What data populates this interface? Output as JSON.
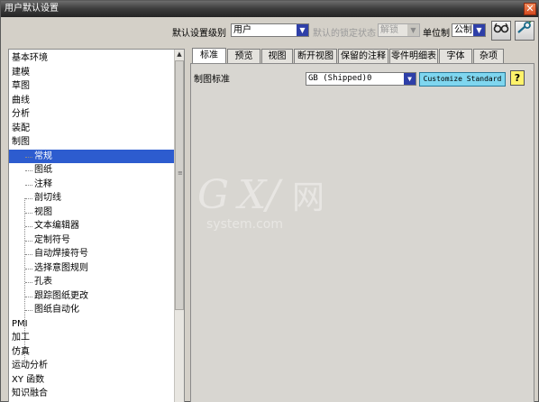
{
  "window": {
    "title": "用户默认设置",
    "close_glyph": "✕"
  },
  "toolbar": {
    "level_label": "默认设置级别",
    "level_value": "用户",
    "lock_label": "默认的锁定状态",
    "lock_value": "解锁",
    "unit_label": "单位制",
    "unit_value": "公制",
    "icon_1": "glasses-search-icon",
    "icon_2": "wrench-icon"
  },
  "tree": {
    "items": [
      {
        "label": "基本环境",
        "sub": false
      },
      {
        "label": "建模",
        "sub": false
      },
      {
        "label": "草图",
        "sub": false
      },
      {
        "label": "曲线",
        "sub": false
      },
      {
        "label": "分析",
        "sub": false
      },
      {
        "label": "装配",
        "sub": false
      },
      {
        "label": "制图",
        "sub": false
      },
      {
        "label": "常规",
        "sub": true,
        "selected": true
      },
      {
        "label": "图纸",
        "sub": true
      },
      {
        "label": "注释",
        "sub": true
      },
      {
        "label": "剖切线",
        "sub": true
      },
      {
        "label": "视图",
        "sub": true
      },
      {
        "label": "文本编辑器",
        "sub": true
      },
      {
        "label": "定制符号",
        "sub": true
      },
      {
        "label": "自动焊接符号",
        "sub": true
      },
      {
        "label": "选择意图规则",
        "sub": true
      },
      {
        "label": "孔表",
        "sub": true
      },
      {
        "label": "跟踪图纸更改",
        "sub": true
      },
      {
        "label": "图纸自动化",
        "sub": true
      },
      {
        "label": "PMI",
        "sub": false
      },
      {
        "label": "加工",
        "sub": false
      },
      {
        "label": "仿真",
        "sub": false
      },
      {
        "label": "运动分析",
        "sub": false
      },
      {
        "label": "XY 函数",
        "sub": false
      },
      {
        "label": "知识融合",
        "sub": false
      }
    ]
  },
  "tabs": [
    {
      "label": "标准",
      "active": true
    },
    {
      "label": "预览"
    },
    {
      "label": "视图"
    },
    {
      "label": "断开视图"
    },
    {
      "label": "保留的注释"
    },
    {
      "label": "零件明细表"
    },
    {
      "label": "字体"
    },
    {
      "label": "杂项"
    }
  ],
  "content": {
    "std_label": "制图标准",
    "std_value": "GB (Shipped)0",
    "customize_label": "Customize Standard",
    "help_glyph": "?"
  },
  "colors": {
    "selection": "#2d5ccf",
    "customize_button": "#7fd6ef",
    "help_button": "#fff36a"
  }
}
